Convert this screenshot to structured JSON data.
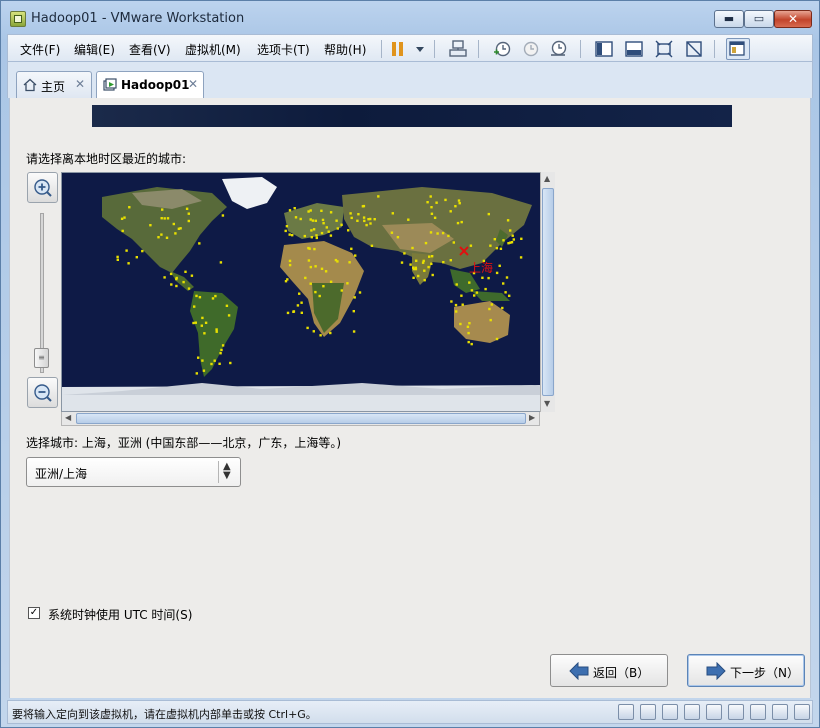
{
  "window": {
    "title": "Hadoop01 - VMware Workstation",
    "min_glyph": "▬",
    "max_glyph": "▭",
    "close_glyph": "✕"
  },
  "menu": {
    "items": [
      "文件(F)",
      "编辑(E)",
      "查看(V)",
      "虚拟机(M)",
      "选项卡(T)",
      "帮助(H)"
    ]
  },
  "toolbar": {
    "icons": [
      "pause-icon",
      "dropdown-arrow-icon",
      "send-keys-icon",
      "snapshot-take-icon",
      "snapshot-revert-icon",
      "snapshot-manager-icon",
      "console-view-icon",
      "unity-icon",
      "fullscreen-icon",
      "stretch-icon",
      "library-icon"
    ]
  },
  "tabs": [
    {
      "label": "主页",
      "icon": "home-icon",
      "close": "✕"
    },
    {
      "label": "Hadoop01",
      "icon": "vm-running-icon",
      "close": "✕"
    }
  ],
  "installer": {
    "prompt": "请选择离本地时区最近的城市:",
    "map_city_label": "上海",
    "selected_city_text": "选择城市: 上海，亚洲 (中国东部——北京，广东，上海等。)",
    "timezone_select_value": "亚洲/上海",
    "utc_checkbox_label": "系统时钟使用 UTC 时间(S)",
    "utc_checked": true,
    "utc_check_glyph": "✓",
    "back_button": "返回（B）",
    "next_button": "下一步（N）"
  },
  "status": {
    "text": "要将输入定向到该虚拟机，请在虚拟机内部单击或按 Ctrl+G。"
  },
  "colors": {
    "accent": "#3d6fb0",
    "map_ocean": "#0e1a46",
    "city_marker": "#e8e000",
    "selected_marker": "#e01010"
  }
}
